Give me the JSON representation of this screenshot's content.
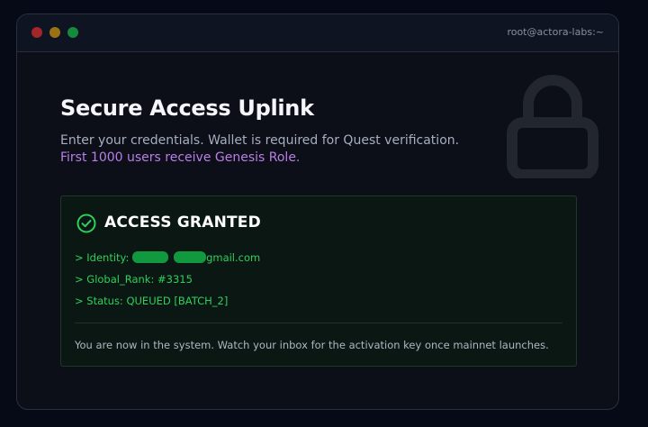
{
  "window": {
    "host": "root@actora-labs:~"
  },
  "header": {
    "title": "Secure Access Uplink",
    "subtitle": "Enter your credentials. Wallet is required for Quest verification.",
    "promo": "First 1000 users receive Genesis Role."
  },
  "icons": {
    "lock": "lock-icon",
    "check": "check-circle-icon"
  },
  "status": {
    "heading": "ACCESS GRANTED",
    "identity_label": "> Identity: ",
    "identity_suffix": "gmail.com",
    "rank": "> Global_Rank: #3315",
    "status": "> Status: QUEUED [BATCH_2]",
    "footer": "You are now in the system. Watch your inbox for the activation key once mainnet launches."
  },
  "colors": {
    "accent_green": "#2fcf5e",
    "promo_purple": "#b97ee8",
    "lock_gray": "#22262e"
  }
}
